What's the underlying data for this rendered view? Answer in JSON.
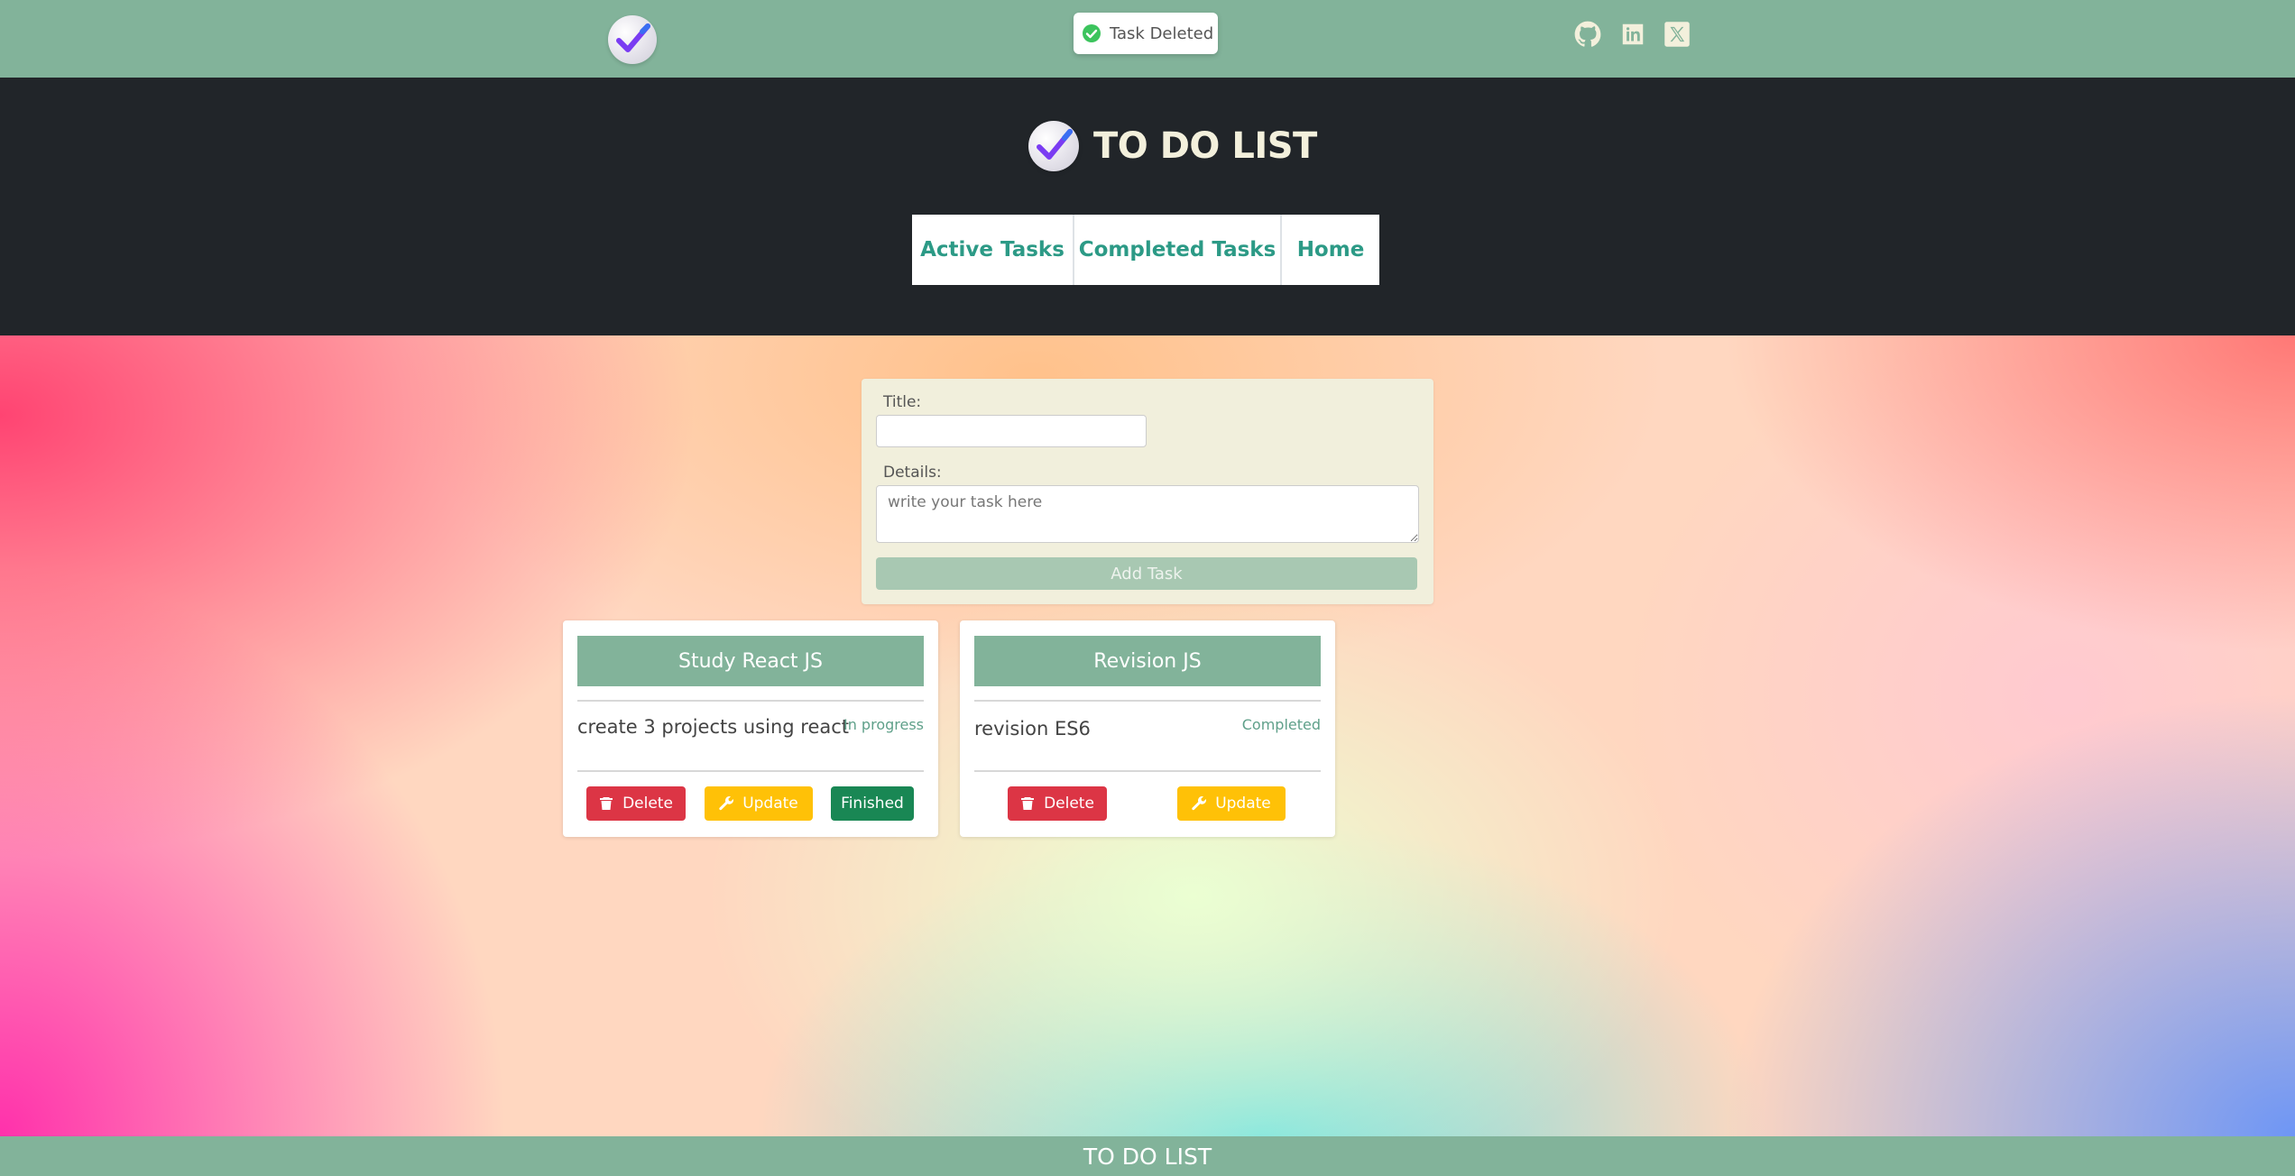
{
  "topbar": {
    "logo_icon": "checkmark-logo-icon",
    "toast": {
      "icon": "check-circle-icon",
      "text": "Task Deleted"
    },
    "social": [
      {
        "name": "github-icon"
      },
      {
        "name": "linkedin-icon"
      },
      {
        "name": "x-twitter-icon"
      }
    ]
  },
  "header": {
    "title": "TO DO LIST",
    "nav": [
      "Active Tasks",
      "Completed Tasks",
      "Home"
    ]
  },
  "form": {
    "title_label": "Title:",
    "title_value": "",
    "details_label": "Details:",
    "details_placeholder": "write your task here",
    "add_button": "Add Task"
  },
  "tasks": [
    {
      "title": "Study React JS",
      "details": "create 3 projects using react",
      "status": "In progress",
      "buttons": {
        "delete": "Delete",
        "update": "Update",
        "finished": "Finished"
      }
    },
    {
      "title": "Revision JS",
      "details": "revision ES6",
      "status": "Completed",
      "buttons": {
        "delete": "Delete",
        "update": "Update"
      }
    }
  ],
  "footer": {
    "text": "TO DO LIST"
  },
  "colors": {
    "topbar": "#82b39a",
    "header": "#212529",
    "nav_text": "#2c9a86",
    "delete": "#dc3545",
    "update": "#ffc107",
    "finished": "#198754"
  }
}
